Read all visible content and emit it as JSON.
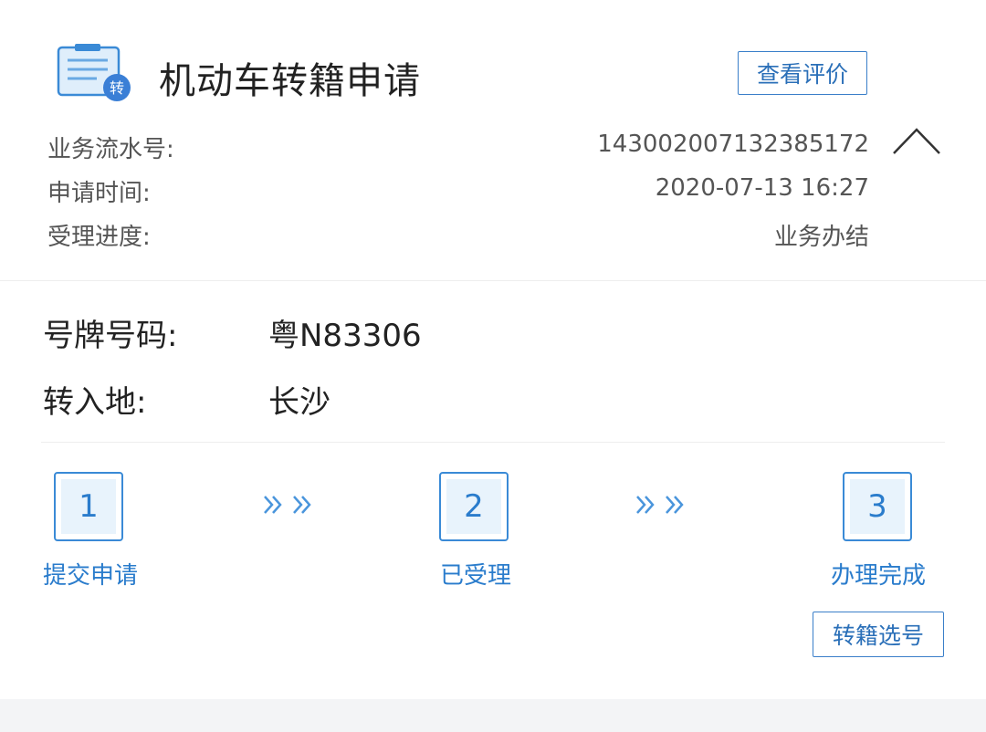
{
  "header": {
    "title": "机动车转籍申请",
    "icon_badge": "转",
    "review_button": "查看评价",
    "colors": {
      "accent": "#3a7fc9",
      "icon_blue": "#3a8ad6"
    }
  },
  "info": [
    {
      "label": "业务流水号:",
      "value": "143002007132385172"
    },
    {
      "label": "申请时间:",
      "value": "2020-07-13 16:27"
    },
    {
      "label": "受理进度:",
      "value": "业务办结"
    }
  ],
  "details": [
    {
      "label": "号牌号码:",
      "value": "粤N83306"
    },
    {
      "label": "转入地:",
      "value": "长沙"
    }
  ],
  "steps": [
    {
      "number": "1",
      "label": "提交申请"
    },
    {
      "number": "2",
      "label": "已受理"
    },
    {
      "number": "3",
      "label": "办理完成"
    }
  ],
  "select_button": "转籍选号"
}
